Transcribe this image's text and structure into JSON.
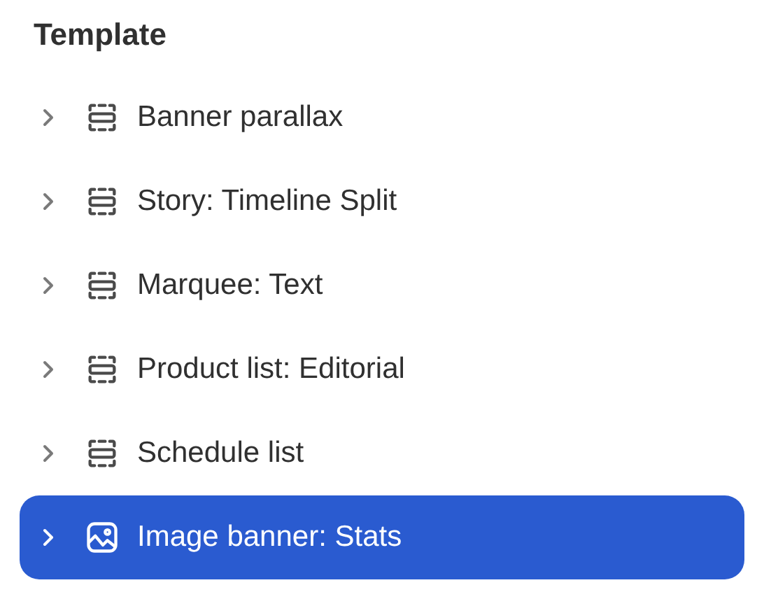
{
  "heading": "Template",
  "items": [
    {
      "label": "Banner parallax",
      "kind": "section",
      "selected": false,
      "expanded": false
    },
    {
      "label": "Story: Timeline Split",
      "kind": "section",
      "selected": false,
      "expanded": false
    },
    {
      "label": "Marquee: Text",
      "kind": "section",
      "selected": false,
      "expanded": false
    },
    {
      "label": "Product list: Editorial",
      "kind": "section",
      "selected": false,
      "expanded": false
    },
    {
      "label": "Schedule list",
      "kind": "section",
      "selected": false,
      "expanded": false
    },
    {
      "label": "Image banner: Stats",
      "kind": "image",
      "selected": true,
      "expanded": false
    }
  ]
}
